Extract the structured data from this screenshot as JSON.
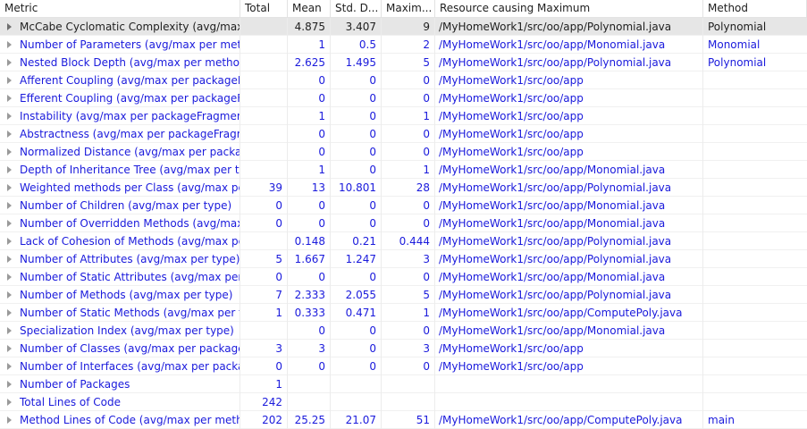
{
  "columns": {
    "metric": "Metric",
    "total": "Total",
    "mean": "Mean",
    "std": "Std. D...",
    "max": "Maxim...",
    "resource": "Resource causing Maximum",
    "method": "Method"
  },
  "rows": [
    {
      "metric": "McCabe Cyclomatic Complexity (avg/max",
      "total": "",
      "mean": "4.875",
      "std": "3.407",
      "max": "9",
      "resource": "/MyHomeWork1/src/oo/app/Polynomial.java",
      "method": "Polynomial"
    },
    {
      "metric": "Number of Parameters (avg/max per meth",
      "total": "",
      "mean": "1",
      "std": "0.5",
      "max": "2",
      "resource": "/MyHomeWork1/src/oo/app/Monomial.java",
      "method": "Monomial"
    },
    {
      "metric": "Nested Block Depth (avg/max per methoc",
      "total": "",
      "mean": "2.625",
      "std": "1.495",
      "max": "5",
      "resource": "/MyHomeWork1/src/oo/app/Polynomial.java",
      "method": "Polynomial"
    },
    {
      "metric": "Afferent Coupling (avg/max per packageF",
      "total": "",
      "mean": "0",
      "std": "0",
      "max": "0",
      "resource": "/MyHomeWork1/src/oo/app",
      "method": ""
    },
    {
      "metric": "Efferent Coupling (avg/max per packageFr",
      "total": "",
      "mean": "0",
      "std": "0",
      "max": "0",
      "resource": "/MyHomeWork1/src/oo/app",
      "method": ""
    },
    {
      "metric": "Instability (avg/max per packageFragment",
      "total": "",
      "mean": "1",
      "std": "0",
      "max": "1",
      "resource": "/MyHomeWork1/src/oo/app",
      "method": ""
    },
    {
      "metric": "Abstractness (avg/max per packageFragm",
      "total": "",
      "mean": "0",
      "std": "0",
      "max": "0",
      "resource": "/MyHomeWork1/src/oo/app",
      "method": ""
    },
    {
      "metric": "Normalized Distance (avg/max per packag",
      "total": "",
      "mean": "0",
      "std": "0",
      "max": "0",
      "resource": "/MyHomeWork1/src/oo/app",
      "method": ""
    },
    {
      "metric": "Depth of Inheritance Tree (avg/max per ty",
      "total": "",
      "mean": "1",
      "std": "0",
      "max": "1",
      "resource": "/MyHomeWork1/src/oo/app/Monomial.java",
      "method": ""
    },
    {
      "metric": "Weighted methods per Class (avg/max pe",
      "total": "39",
      "mean": "13",
      "std": "10.801",
      "max": "28",
      "resource": "/MyHomeWork1/src/oo/app/Polynomial.java",
      "method": ""
    },
    {
      "metric": "Number of Children (avg/max per type)",
      "total": "0",
      "mean": "0",
      "std": "0",
      "max": "0",
      "resource": "/MyHomeWork1/src/oo/app/Monomial.java",
      "method": ""
    },
    {
      "metric": "Number of Overridden Methods (avg/max",
      "total": "0",
      "mean": "0",
      "std": "0",
      "max": "0",
      "resource": "/MyHomeWork1/src/oo/app/Monomial.java",
      "method": ""
    },
    {
      "metric": "Lack of Cohesion of Methods (avg/max pe",
      "total": "",
      "mean": "0.148",
      "std": "0.21",
      "max": "0.444",
      "resource": "/MyHomeWork1/src/oo/app/Polynomial.java",
      "method": ""
    },
    {
      "metric": "Number of Attributes (avg/max per type)",
      "total": "5",
      "mean": "1.667",
      "std": "1.247",
      "max": "3",
      "resource": "/MyHomeWork1/src/oo/app/Polynomial.java",
      "method": ""
    },
    {
      "metric": "Number of Static Attributes (avg/max per",
      "total": "0",
      "mean": "0",
      "std": "0",
      "max": "0",
      "resource": "/MyHomeWork1/src/oo/app/Monomial.java",
      "method": ""
    },
    {
      "metric": "Number of Methods (avg/max per type)",
      "total": "7",
      "mean": "2.333",
      "std": "2.055",
      "max": "5",
      "resource": "/MyHomeWork1/src/oo/app/Polynomial.java",
      "method": ""
    },
    {
      "metric": "Number of Static Methods (avg/max per t",
      "total": "1",
      "mean": "0.333",
      "std": "0.471",
      "max": "1",
      "resource": "/MyHomeWork1/src/oo/app/ComputePoly.java",
      "method": ""
    },
    {
      "metric": "Specialization Index (avg/max per type)",
      "total": "",
      "mean": "0",
      "std": "0",
      "max": "0",
      "resource": "/MyHomeWork1/src/oo/app/Monomial.java",
      "method": ""
    },
    {
      "metric": "Number of Classes (avg/max per package",
      "total": "3",
      "mean": "3",
      "std": "0",
      "max": "3",
      "resource": "/MyHomeWork1/src/oo/app",
      "method": ""
    },
    {
      "metric": "Number of Interfaces (avg/max per packa",
      "total": "0",
      "mean": "0",
      "std": "0",
      "max": "0",
      "resource": "/MyHomeWork1/src/oo/app",
      "method": ""
    },
    {
      "metric": "Number of Packages",
      "total": "1",
      "mean": "",
      "std": "",
      "max": "",
      "resource": "",
      "method": ""
    },
    {
      "metric": "Total Lines of Code",
      "total": "242",
      "mean": "",
      "std": "",
      "max": "",
      "resource": "",
      "method": ""
    },
    {
      "metric": "Method Lines of Code (avg/max per meth",
      "total": "202",
      "mean": "25.25",
      "std": "21.07",
      "max": "51",
      "resource": "/MyHomeWork1/src/oo/app/ComputePoly.java",
      "method": "main"
    }
  ],
  "selected_row": 0,
  "colors": {
    "link_text": "#1a1adc",
    "selected_bg": "#e6e6e6",
    "header_text": "#1e1e1e"
  }
}
